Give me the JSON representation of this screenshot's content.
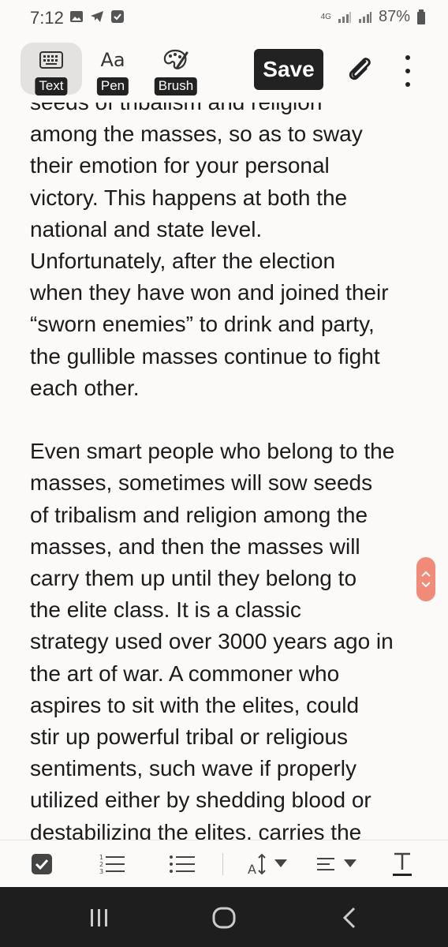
{
  "status_bar": {
    "time": "7:12",
    "network": "4G",
    "battery": "87%",
    "icons_left": [
      "image-icon",
      "telegram-icon",
      "checkbox-notification-icon"
    ]
  },
  "toolbar": {
    "tools": [
      {
        "label": "Text",
        "icon": "keyboard-icon",
        "active": true
      },
      {
        "label": "Pen",
        "icon": "text-style-icon",
        "active": false
      },
      {
        "label": "Brush",
        "icon": "palette-icon",
        "active": false
      }
    ],
    "save_label": "Save",
    "attach_icon": "paperclip-icon",
    "more_icon": "more-vertical-icon"
  },
  "note": {
    "partial_top_line": "seeds of tribalism and religion",
    "paragraph_1": [
      "among the masses, so as to sway",
      "their emotion for your personal",
      "victory. This happens at both the",
      "national and state level.",
      "Unfortunately, after the election",
      "when they have won and joined their",
      "“sworn enemies” to drink and party,",
      "the gullible masses continue to fight",
      "each other."
    ],
    "paragraph_2": [
      "Even smart people who belong to the",
      "masses, sometimes will sow seeds",
      "of tribalism and religion among the",
      "masses, and then the masses will",
      "carry them up until they belong to",
      "the elite class.  It is a classic",
      "strategy used over 3000 years ago in",
      "the art of war. A commoner who",
      "aspires to sit with the elites, could",
      "stir up powerful tribal or religious",
      "sentiments, such wave if properly",
      "utilized either by shedding blood or",
      "destabilizing the elites, carries the"
    ]
  },
  "format_bar": {
    "items": [
      "checkbox-icon",
      "numbered-list-icon",
      "bullet-list-icon",
      "font-size-icon",
      "align-icon",
      "text-format-icon"
    ]
  },
  "colors": {
    "accent": "#f08b79",
    "background": "#fbfaf9",
    "nav_bar": "#1e1e1e"
  }
}
